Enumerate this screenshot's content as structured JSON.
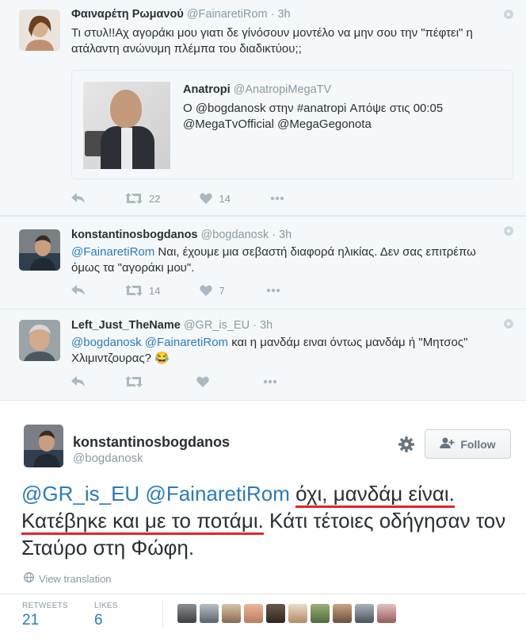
{
  "tweets": [
    {
      "name": "Φαιναρέτη Ρωμανού",
      "handle": "@FainaretiRom",
      "dot": "·",
      "time": "3h",
      "text": "Τι στυλ!!Αχ αγοράκι μου γιατι δε γίνόσουν μοντέλο να μην σου την \"πέφτει\" η ατάλαντη ανώνυμη πλέμπα του διαδικτύου;;",
      "quote": {
        "name": "Anatropi",
        "handle": "@AnatropiMegaTV",
        "text": "Ο @bogdanosk στην #anatropi Απόψε στις 00:05 @MegaTvOfficial @MegaGegonota"
      },
      "retweets": "22",
      "likes": "14"
    },
    {
      "name": "konstantinosbogdanos",
      "handle": "@bogdanosk",
      "dot": "·",
      "time": "3h",
      "mention": "@FainaretiRom",
      "text": " Ναι, έχουμε μια σεβαστή διαφορά ηλικίας. Δεν σας επιτρέπω όμως τα \"αγοράκι μου\".",
      "retweets": "14",
      "likes": "7"
    },
    {
      "name": "Left_Just_TheName",
      "handle": "@GR_is_EU",
      "dot": "·",
      "time": "3h",
      "mention": "@bogdanosk @FainaretiRom",
      "text": " και η μανδάμ ειναι όντως μανδάμ ή \"Μητσος\" Χλιμιντζουρας? 😂",
      "retweets": "",
      "likes": ""
    }
  ],
  "main": {
    "name": "konstantinosbogdanos",
    "handle": "@bogdanosk",
    "follow_label": "Follow",
    "mentions": "@GR_is_EU @FainaretiRom",
    "text_part1": "όχι, μανδάμ είναι.",
    "text_part2": "Κατέβηκε και με το ποτάμι.",
    "text_part3": " Κάτι τέτοιες οδήγησαν τον Σταύρο στη Φώφη.",
    "view_translation": "View translation",
    "retweets_label": "RETWEETS",
    "retweets_count": "21",
    "likes_label": "LIKES",
    "likes_count": "6"
  },
  "colors": {
    "link": "#2b7bb9",
    "muted": "#8899a6",
    "underline": "#e0262a",
    "thread_bg": "#f5f8fa"
  },
  "icons": [
    "reply-icon",
    "retweet-icon",
    "like-icon",
    "more-icon",
    "gear-icon",
    "follow-icon",
    "globe-icon"
  ]
}
